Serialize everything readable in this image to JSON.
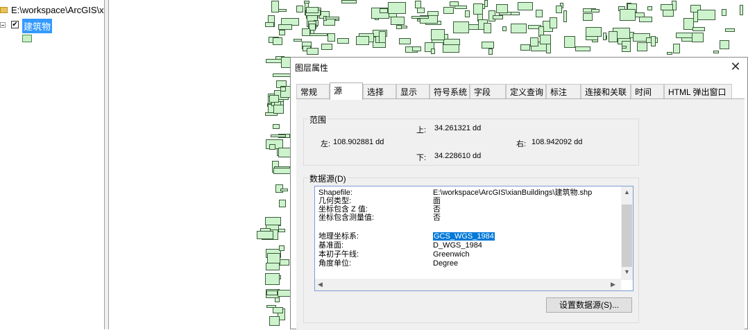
{
  "toc": {
    "workspace_path": "E:\\workspace\\ArcGIS\\x",
    "layer_name": "建筑物",
    "layer_checked": "✔"
  },
  "dialog": {
    "title": "图层属性",
    "close_glyph": "✕",
    "tabs": [
      "常规",
      "源",
      "选择",
      "显示",
      "符号系统",
      "字段",
      "定义查询",
      "标注",
      "连接和关联",
      "时间",
      "HTML 弹出窗口"
    ],
    "active_tab": "源",
    "extent": {
      "group_title": "范围",
      "top_label": "上:",
      "top_value": "34.261321 dd",
      "left_label": "左:",
      "left_value": "108.902881 dd",
      "right_label": "右:",
      "right_value": "108.942092 dd",
      "bottom_label": "下:",
      "bottom_value": "34.228610 dd"
    },
    "datasource": {
      "group_title": "数据源(D)",
      "rows": [
        {
          "label": "Shapefile:",
          "value": "E:\\workspace\\ArcGIS\\xianBuildings\\建筑物.shp"
        },
        {
          "label": "几何类型:",
          "value": "面"
        },
        {
          "label": "坐标包含 Z 值:",
          "value": "否"
        },
        {
          "label": "坐标包含测量值:",
          "value": "否"
        },
        {
          "label": "地理坐标系:",
          "value": "GCS_WGS_1984"
        },
        {
          "label": "基准面:",
          "value": "D_WGS_1984"
        },
        {
          "label": "本初子午线:",
          "value": "Greenwich"
        },
        {
          "label": "角度单位:",
          "value": "Degree"
        }
      ],
      "selected_value": "GCS_WGS_1984"
    },
    "set_datasource_button": "设置数据源(S)..."
  }
}
